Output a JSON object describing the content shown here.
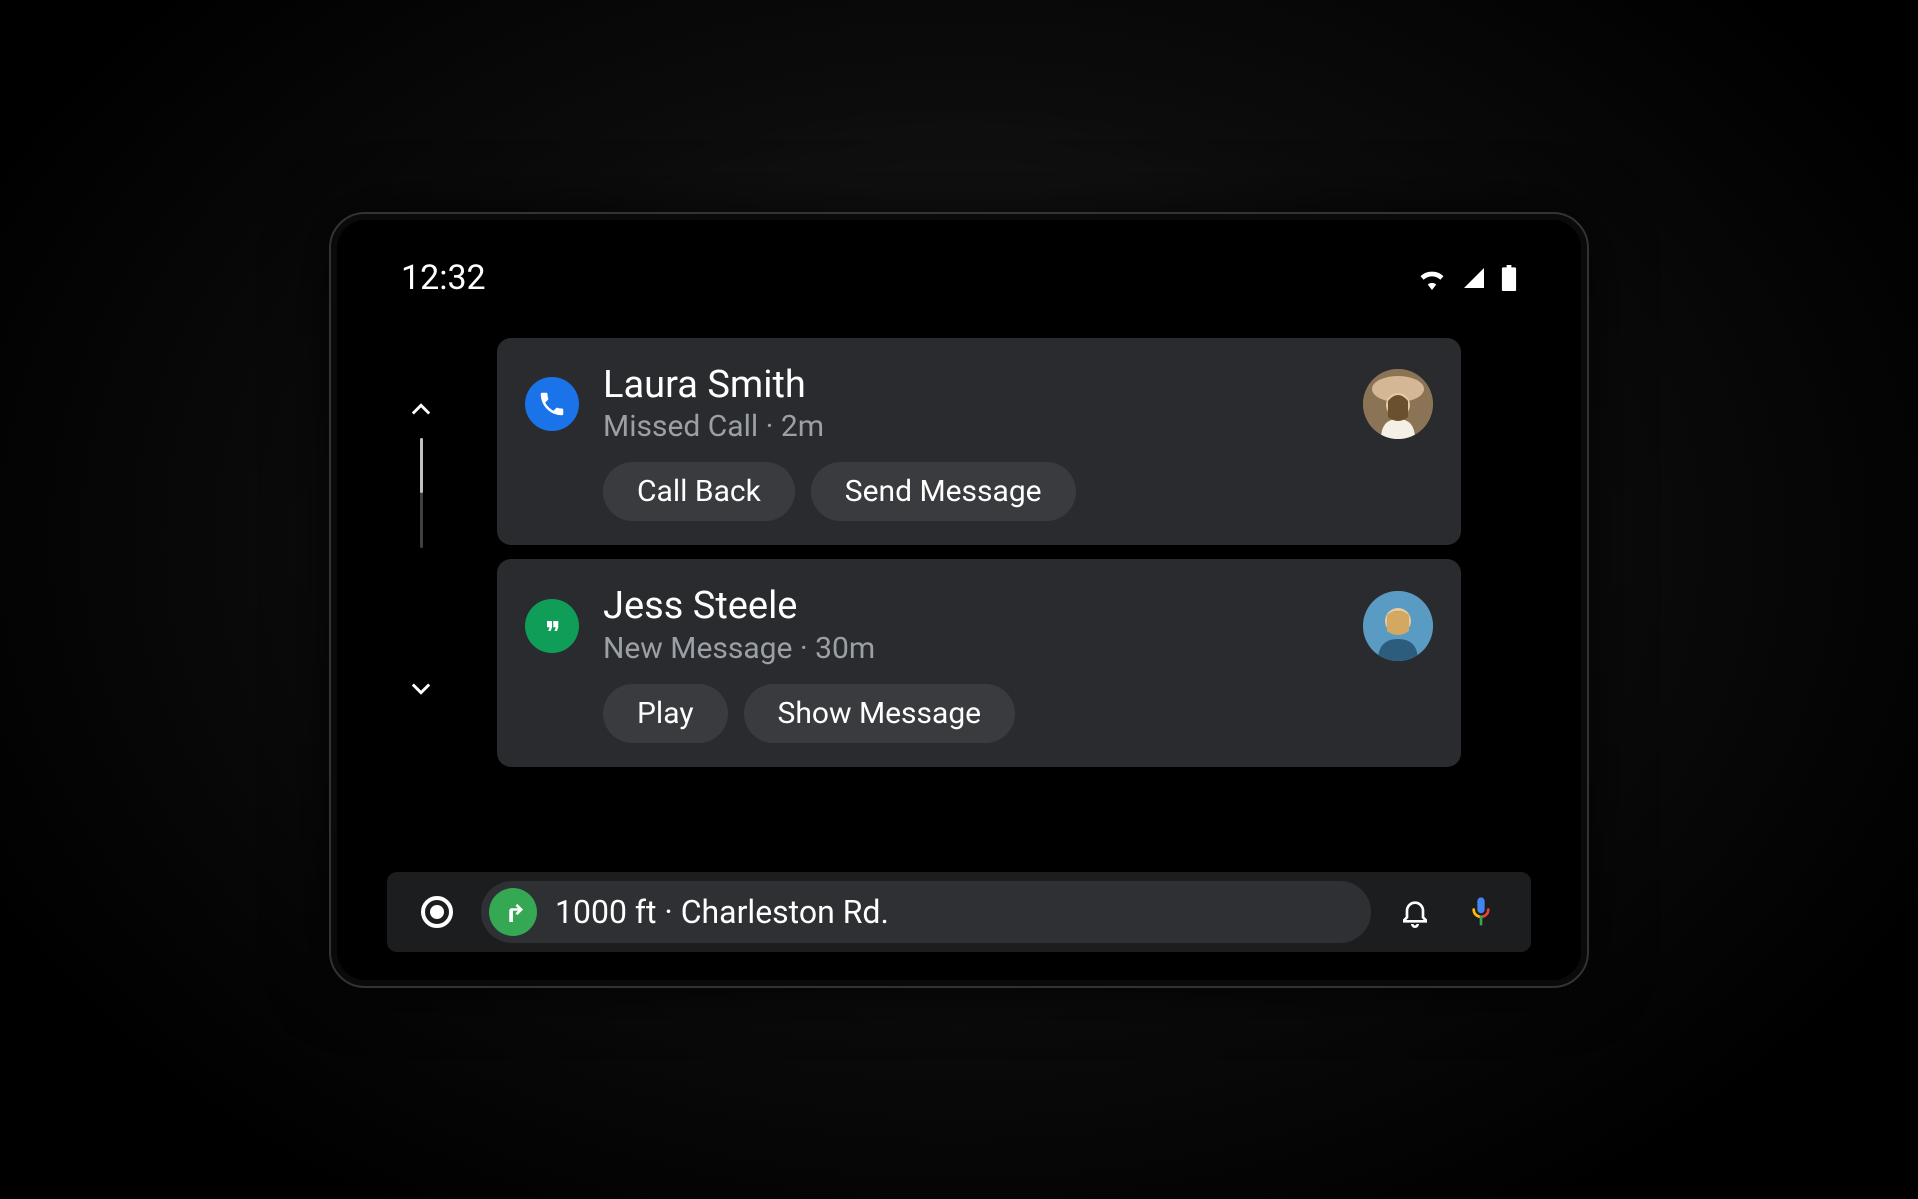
{
  "status": {
    "time": "12:32",
    "icons": [
      "wifi-icon",
      "signal-icon",
      "battery-icon"
    ]
  },
  "notifications": [
    {
      "app_icon": "phone-icon",
      "app_color": "#1a73e8",
      "title": "Laura Smith",
      "subtitle": "Missed Call · 2m",
      "actions": [
        "Call Back",
        "Send Message"
      ],
      "avatar": "avatar-1"
    },
    {
      "app_icon": "hangouts-icon",
      "app_color": "#0f9d58",
      "title": "Jess Steele",
      "subtitle": "New Message · 30m",
      "actions": [
        "Play",
        "Show Message"
      ],
      "avatar": "avatar-2"
    }
  ],
  "nav": {
    "turn_icon": "turn-right-icon",
    "text": "1000 ft · Charleston Rd."
  },
  "nav_bar": {
    "launcher_icon": "launcher-icon",
    "bell_icon": "bell-icon",
    "mic_icon": "assistant-mic-icon"
  }
}
